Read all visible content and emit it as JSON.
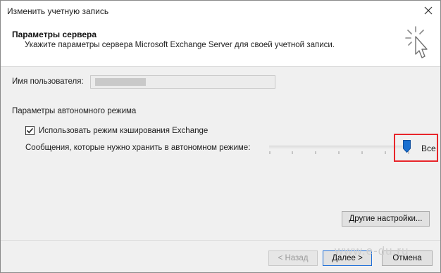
{
  "window": {
    "title": "Изменить учетную запись"
  },
  "header": {
    "title": "Параметры сервера",
    "subtitle": "Укажите параметры сервера Microsoft Exchange Server для своей учетной записи."
  },
  "username": {
    "label": "Имя пользователя:"
  },
  "offline": {
    "section_label": "Параметры автономного режима",
    "cache_checkbox_label": "Использовать режим кэширования Exchange",
    "cache_checked": true,
    "keep_mail_label": "Сообщения, которые нужно хранить в автономном режиме:",
    "slider_value_label": "Все",
    "slider_level": 1.0
  },
  "buttons": {
    "more_settings": "Другие настройки...",
    "back": "< Назад",
    "next": "Далее >",
    "cancel": "Отмена"
  },
  "watermark": "www.e-du.ru",
  "colors": {
    "highlight": "#e8252a",
    "thumb": "#1a6fd0"
  }
}
